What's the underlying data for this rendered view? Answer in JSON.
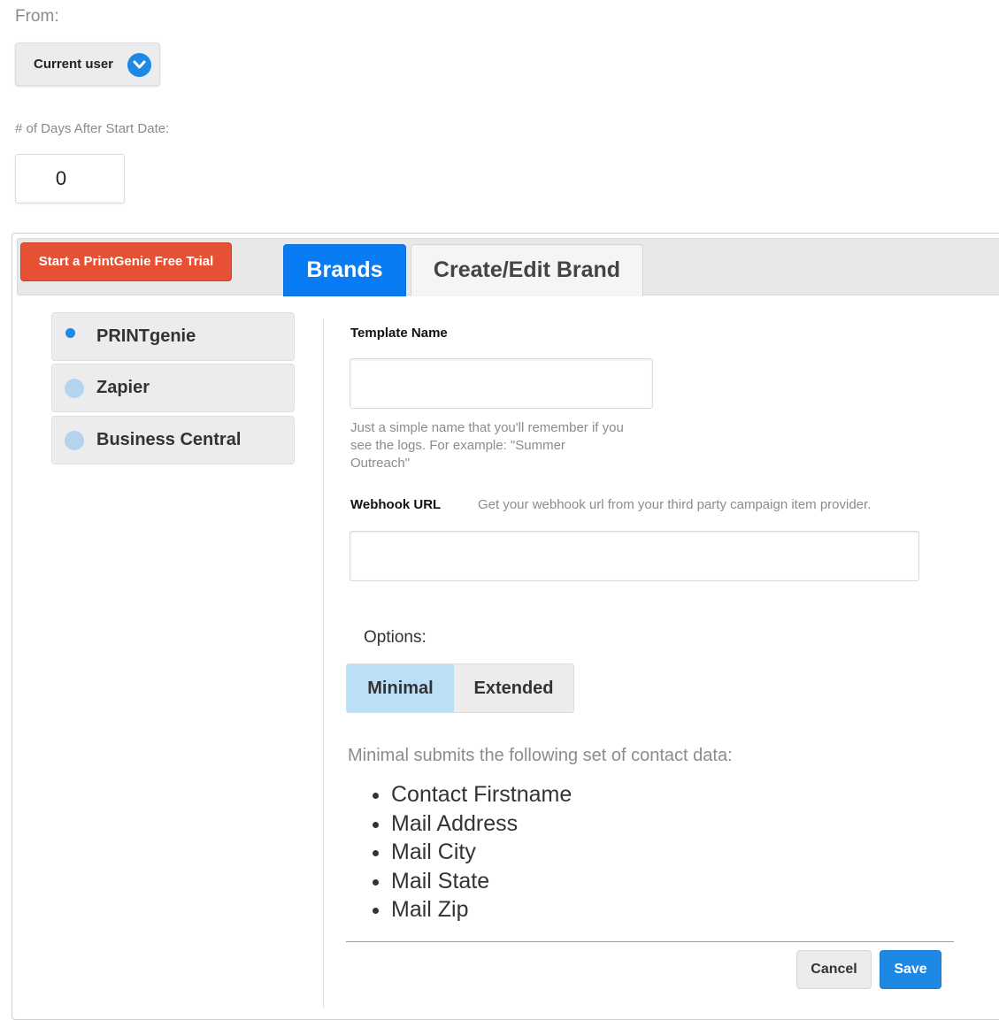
{
  "from": {
    "label": "From:",
    "selected": "Current user",
    "icon": "chevron-down-circle-icon"
  },
  "days": {
    "label": "# of Days After Start Date:",
    "value": "0"
  },
  "toolbar": {
    "trial_button": "Start a PrintGenie Free Trial",
    "tabs": [
      {
        "label": "Brands",
        "active": true
      },
      {
        "label": "Create/Edit Brand",
        "active": false
      }
    ]
  },
  "brands": [
    {
      "name": "PRINTgenie",
      "selected": true
    },
    {
      "name": "Zapier",
      "selected": false
    },
    {
      "name": "Business Central",
      "selected": false
    }
  ],
  "form": {
    "template_name": {
      "label": "Template Name",
      "value": "",
      "help": "Just a simple name that you'll remember if you see the logs. For example: \"Summer Outreach\""
    },
    "webhook_url": {
      "label": "Webhook URL",
      "hint": "Get your webhook url from your third party campaign item provider.",
      "value": ""
    },
    "options": {
      "label": "Options:",
      "choices": [
        "Minimal",
        "Extended"
      ],
      "selected": "Minimal"
    },
    "description": "Minimal submits the following set of contact data:",
    "fields": [
      "Contact Firstname",
      "Mail Address",
      "Mail City",
      "Mail State",
      "Mail Zip"
    ]
  },
  "actions": {
    "cancel": "Cancel",
    "save": "Save"
  },
  "colors": {
    "accent": "#1e88e5",
    "active_tab": "#0a7cf3",
    "trial_button": "#e65133",
    "selected_option": "#bcdff8"
  }
}
